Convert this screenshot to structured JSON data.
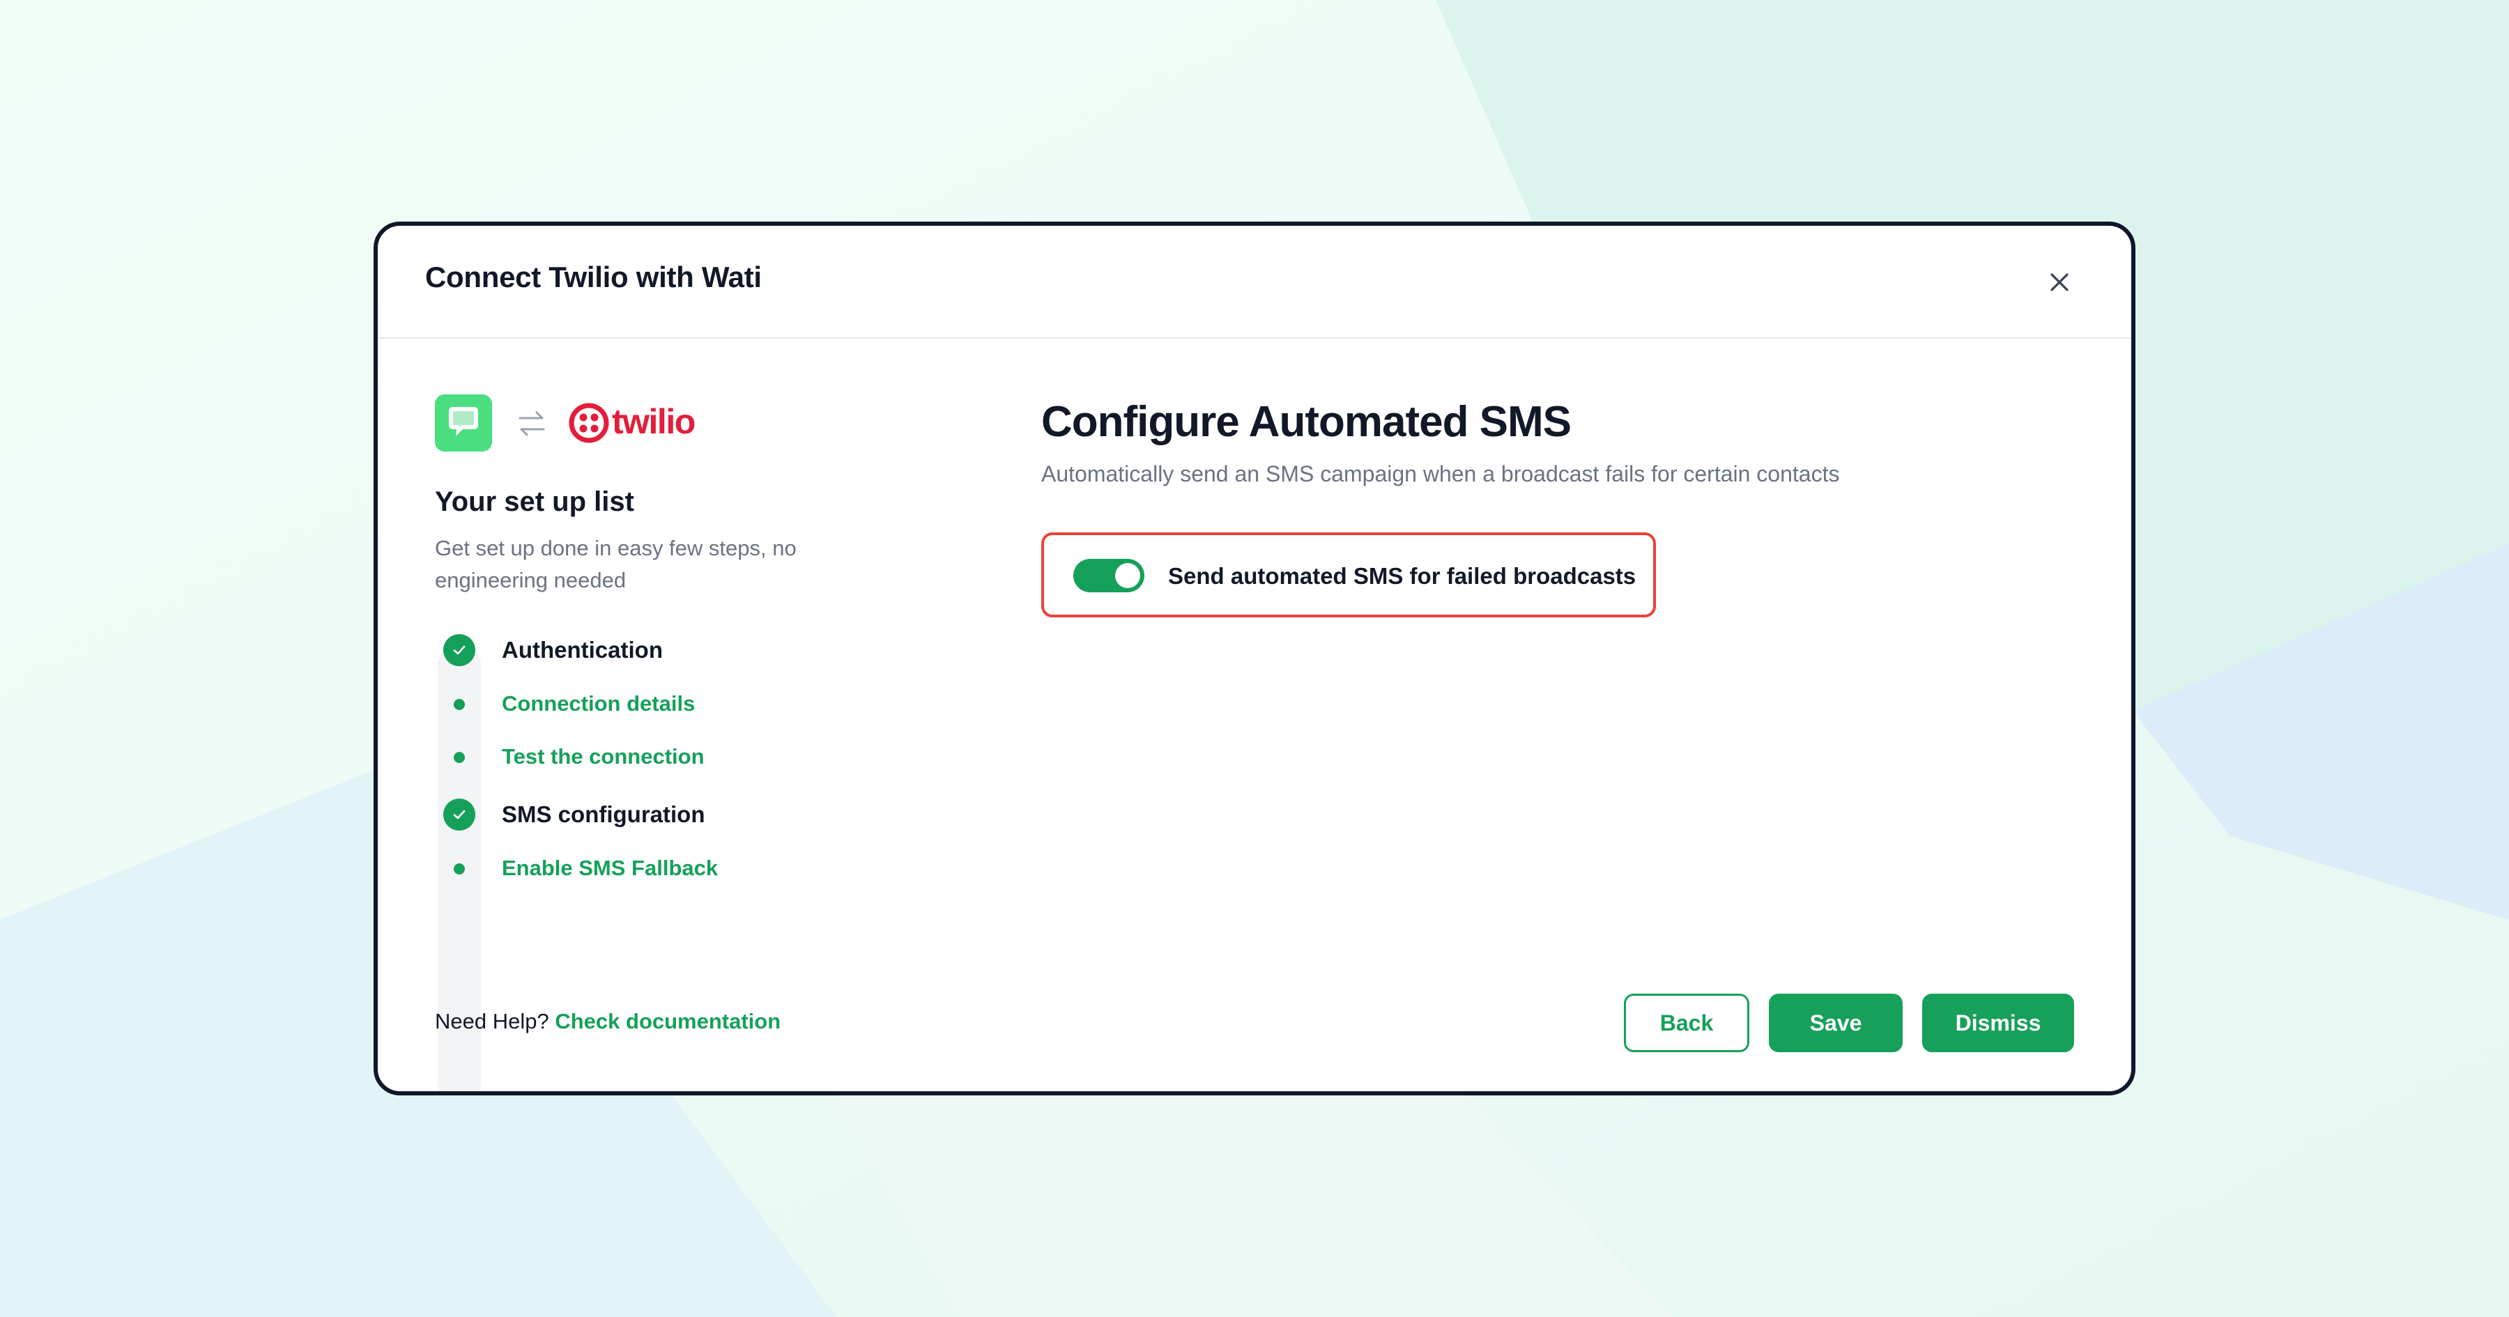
{
  "modal": {
    "title": "Connect Twilio with Wati",
    "close_icon": "close-icon"
  },
  "brand": {
    "partner_name": "twilio",
    "twilio_color": "#e31e3a",
    "wati_color": "#4ade80",
    "accent": "#16a05a"
  },
  "setup": {
    "title": "Your set up list",
    "description": "Get set up done in easy few steps, no engineering needed",
    "steps": [
      {
        "label": "Authentication",
        "kind": "section",
        "icon": "check-circle-icon"
      },
      {
        "label": "Connection details",
        "kind": "substep",
        "icon": "dot-icon"
      },
      {
        "label": "Test the connection",
        "kind": "substep",
        "icon": "dot-icon"
      },
      {
        "label": "SMS configuration",
        "kind": "section",
        "icon": "check-circle-icon"
      },
      {
        "label": "Enable SMS Fallback",
        "kind": "substep",
        "icon": "dot-icon"
      }
    ]
  },
  "help": {
    "prefix": "Need Help?",
    "link": "Check documentation"
  },
  "main": {
    "title": "Configure Automated SMS",
    "description": "Automatically send an SMS campaign when a broadcast fails for certain contacts",
    "toggle": {
      "label": "Send automated SMS for failed broadcasts",
      "on": true,
      "highlight_color": "#e8443a"
    }
  },
  "footer": {
    "back_label": "Back",
    "save_label": "Save",
    "dismiss_label": "Dismiss"
  }
}
